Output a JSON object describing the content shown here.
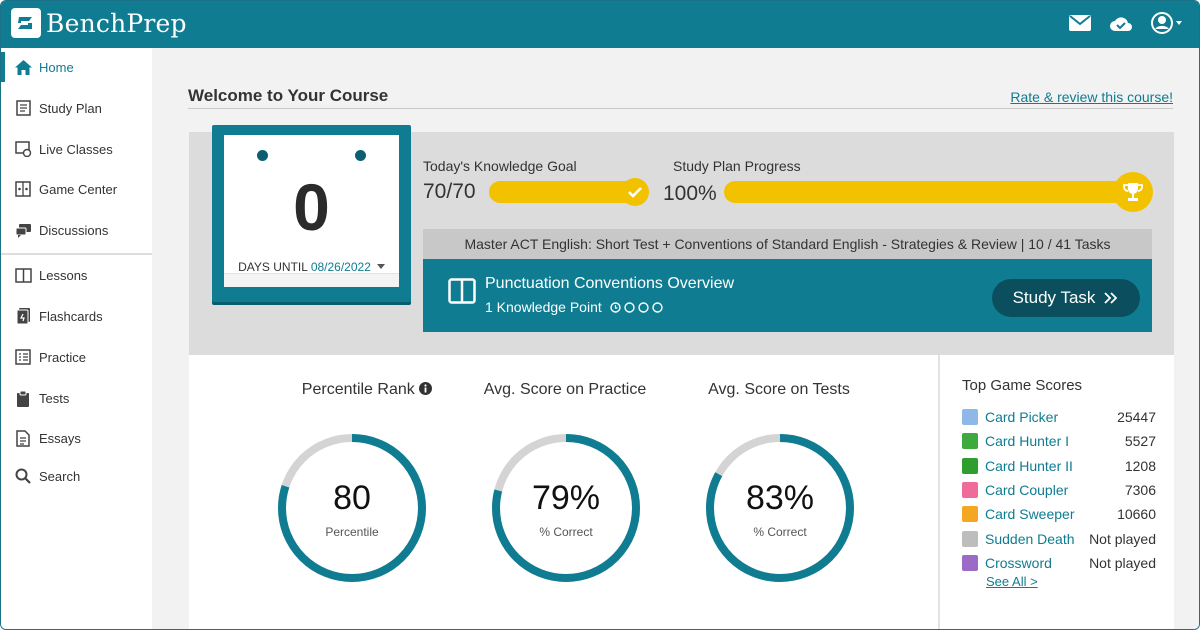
{
  "brand": {
    "name": "BenchPrep"
  },
  "header": {
    "icons": [
      "envelope-icon",
      "cloud-check-icon",
      "user-account-icon"
    ]
  },
  "sidebar": {
    "items": [
      {
        "label": "Home",
        "icon": "home-icon",
        "active": true
      },
      {
        "label": "Study Plan",
        "icon": "study-plan-icon"
      },
      {
        "label": "Live Classes",
        "icon": "live-classes-icon"
      },
      {
        "label": "Game Center",
        "icon": "game-center-icon"
      },
      {
        "label": "Discussions",
        "icon": "discussions-icon"
      },
      {
        "label": "Lessons",
        "icon": "lessons-icon"
      },
      {
        "label": "Flashcards",
        "icon": "flashcards-icon"
      },
      {
        "label": "Practice",
        "icon": "practice-icon"
      },
      {
        "label": "Tests",
        "icon": "tests-icon"
      },
      {
        "label": "Essays",
        "icon": "essays-icon"
      },
      {
        "label": "Search",
        "icon": "search-icon"
      }
    ]
  },
  "main": {
    "title": "Welcome to Your Course",
    "rate_link": "Rate & review this course!"
  },
  "countdown": {
    "days": "0",
    "label": "DAYS UNTIL",
    "date": "08/26/2022"
  },
  "knowledge_goal": {
    "label": "Today's Knowledge Goal",
    "value": "70/70",
    "progress": 1.0
  },
  "study_plan": {
    "label": "Study Plan Progress",
    "value": "100%",
    "progress": 1.0
  },
  "task": {
    "header": "Master ACT English: Short Test + Conventions of Standard English - Strategies & Review | 10 / 41 Tasks",
    "title": "Punctuation Conventions Overview",
    "subtitle": "1 Knowledge Point",
    "button": "Study Task"
  },
  "stats": [
    {
      "title": "Percentile Rank",
      "value": "80",
      "sub": "Percentile",
      "fraction": 0.8,
      "info": true
    },
    {
      "title": "Avg. Score on Practice",
      "value": "79%",
      "sub": "% Correct",
      "fraction": 0.79
    },
    {
      "title": "Avg. Score on Tests",
      "value": "83%",
      "sub": "% Correct",
      "fraction": 0.83
    }
  ],
  "game_scores": {
    "title": "Top Game Scores",
    "rows": [
      {
        "name": "Card Picker",
        "score": "25447",
        "color": "#8fb8e8"
      },
      {
        "name": "Card Hunter I",
        "score": "5527",
        "color": "#3caa3c"
      },
      {
        "name": "Card Hunter II",
        "score": "1208",
        "color": "#2e9e2e"
      },
      {
        "name": "Card Coupler",
        "score": "7306",
        "color": "#f06a9a"
      },
      {
        "name": "Card Sweeper",
        "score": "10660",
        "color": "#f5a623"
      },
      {
        "name": "Sudden Death",
        "score": "Not played",
        "color": "#bdbdbd"
      },
      {
        "name": "Crossword",
        "score": "Not played",
        "color": "#9b6bc8"
      }
    ],
    "see_all": "See All >"
  },
  "colors": {
    "brand": "#0f7c91",
    "accent": "#f2c200",
    "dark_button": "#0b4f5e"
  }
}
